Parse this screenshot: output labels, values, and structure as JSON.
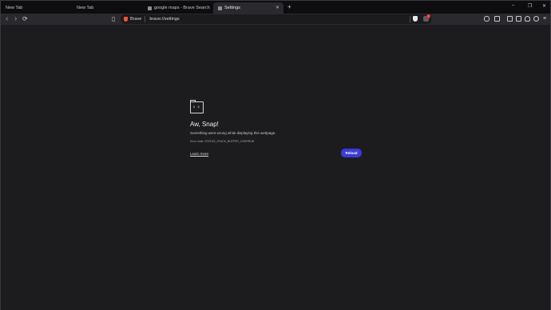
{
  "tabs": [
    {
      "label": "New Tab",
      "active": false
    },
    {
      "label": "New Tab",
      "active": false
    },
    {
      "label": "google maps - Brave Search",
      "active": false
    },
    {
      "label": "Settings",
      "active": true
    }
  ],
  "new_tab_symbol": "+",
  "window_controls": {
    "minimize": "–",
    "maximize": "❐",
    "close": "✕"
  },
  "toolbar": {
    "back": "‹",
    "forward": "›",
    "reload": "⟳",
    "bookmark": "▯",
    "brave_label": "Brave",
    "url": "brave://settings",
    "rewards_badge": "1"
  },
  "error": {
    "title": "Aw, Snap!",
    "message": "Something went wrong while displaying this webpage.",
    "code": "Error code: STATUS_STACK_BUFFER_OVERRUN",
    "learn_more": "Learn more",
    "reload": "Reload",
    "face": "x x"
  },
  "colors": {
    "accent": "#3b3bd8",
    "brave_orange": "#fb542b",
    "background": "#1c1c1f"
  },
  "icons": [
    "back-arrow-icon",
    "forward-arrow-icon",
    "reload-icon",
    "bookmark-icon",
    "brave-shield-icon",
    "rewards-icon",
    "sad-tab-icon"
  ]
}
